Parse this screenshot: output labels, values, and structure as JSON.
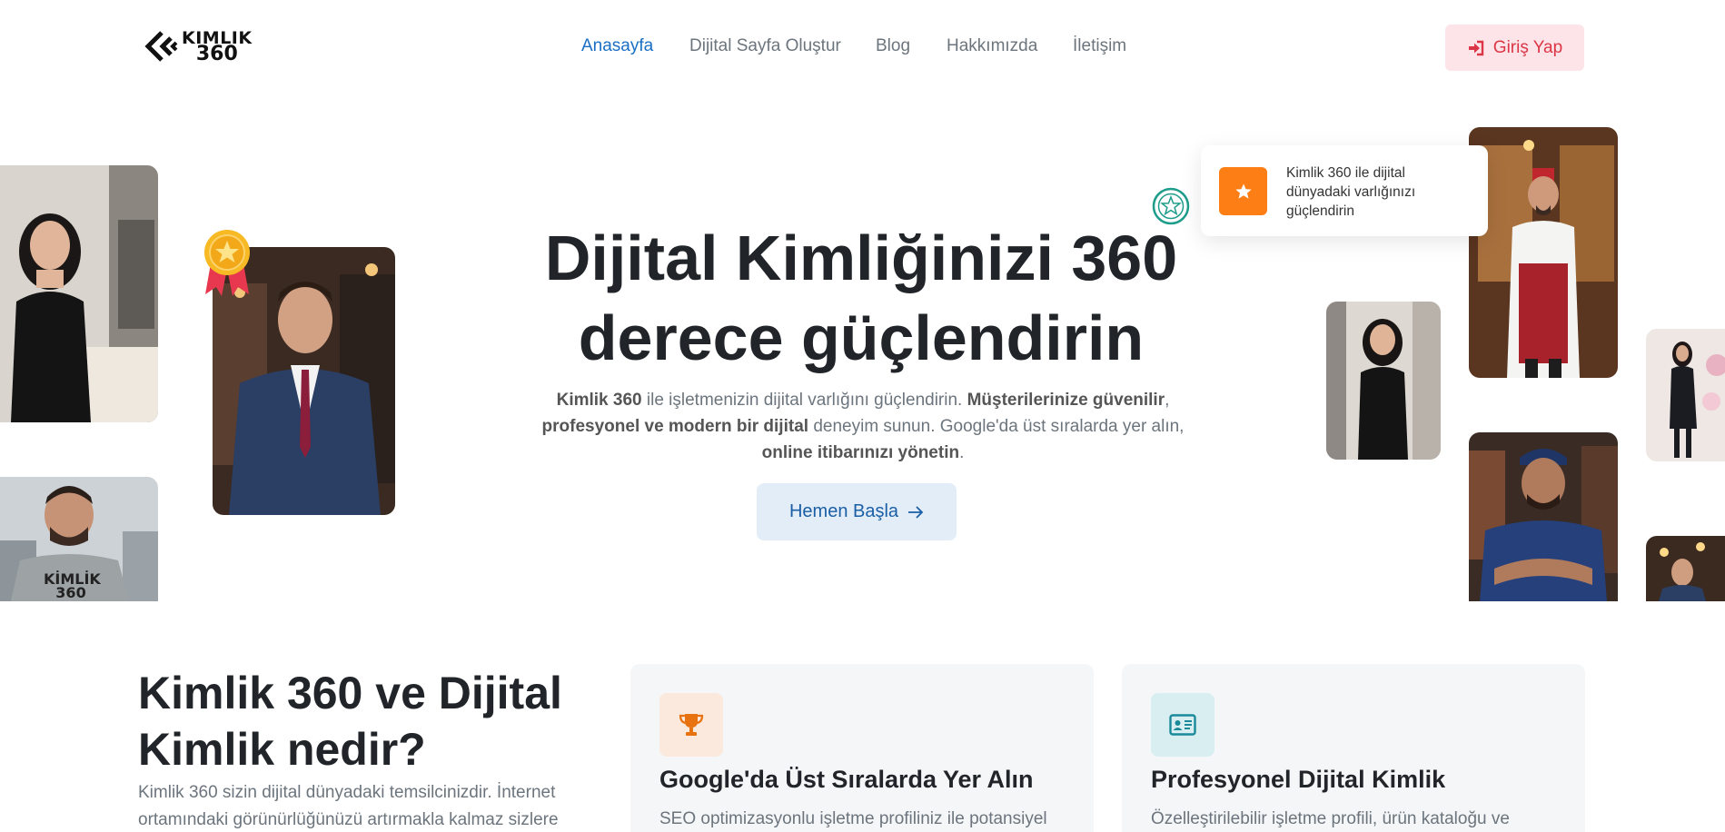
{
  "brand": {
    "line1": "KIMLIK",
    "line2": "360"
  },
  "nav": {
    "items": [
      {
        "label": "Anasayfa",
        "active": true
      },
      {
        "label": "Dijital Sayfa Oluştur",
        "active": false
      },
      {
        "label": "Blog",
        "active": false
      },
      {
        "label": "Hakkımızda",
        "active": false
      },
      {
        "label": "İletişim",
        "active": false
      }
    ],
    "login_label": "Giriş Yap"
  },
  "hero": {
    "title_line1": "Dijital Kimliğinizi 360",
    "title_line2": "derece güçlendirin",
    "desc": {
      "b1": "Kimlik 360",
      "t1": " ile işletmenizin dijital varlığını güçlendirin. ",
      "b2": "Müşterilerinize güvenilir",
      "t2": ", ",
      "b3": "profesyonel ve modern bir dijital",
      "t3": " deneyim sunun. Google'da üst sıralarda yer alın, ",
      "b4": "online itibarınızı yönetin",
      "t4": "."
    },
    "cta_label": "Hemen Başla",
    "badge_text": "Kimlik 360 ile dijital dünyadaki varlığınızı güçlendirin"
  },
  "about": {
    "title": "Kimlik 360 ve Dijital Kimlik nedir?",
    "text": "Kimlik 360 sizin dijital dünyadaki temsilcinizdir. İnternet ortamındaki görünürlüğünüzü artırmakla kalmaz sizlere"
  },
  "features": [
    {
      "icon": "trophy-icon",
      "title": "Google'da Üst Sıralarda Yer Alın",
      "text": "SEO optimizasyonlu işletme profiliniz ile potansiyel"
    },
    {
      "icon": "id-card-icon",
      "title": "Profesyonel Dijital Kimlik",
      "text": "Özelleştirilebilir işletme profili, ürün kataloğu ve"
    }
  ],
  "photo_tiles": [
    {
      "kimlik_shirt_line1": "KİMLİK",
      "kimlik_shirt_line2": "360"
    }
  ],
  "colors": {
    "accent": "#1a6fc4",
    "login": "#dc3545",
    "badge_orange": "#fd7e14",
    "cta_bg": "#e3edf7"
  }
}
